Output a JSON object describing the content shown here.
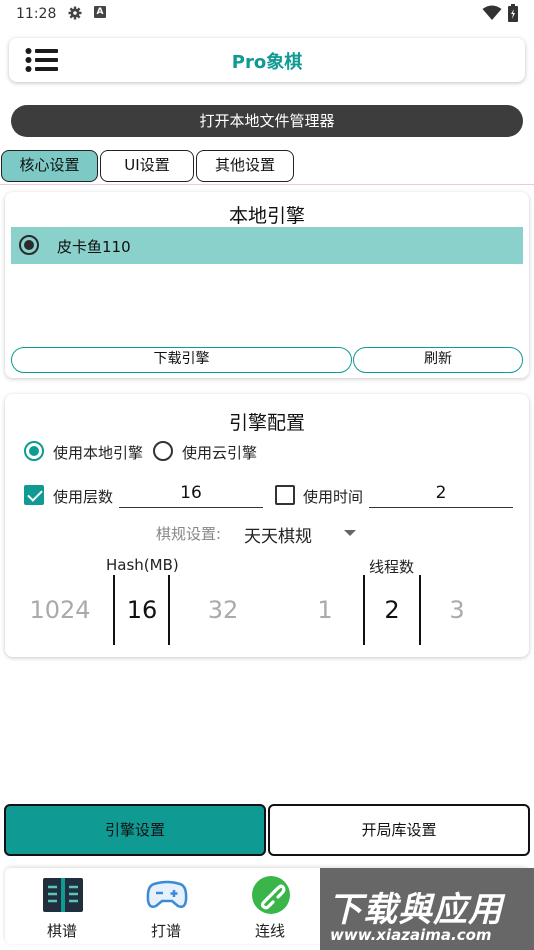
{
  "status_bar": {
    "time": "11:28",
    "notification_letter": "A"
  },
  "app_bar": {
    "title": "Pro象棋"
  },
  "file_manager_button": "打开本地文件管理器",
  "tabs": [
    {
      "label": "核心设置",
      "active": true
    },
    {
      "label": "UI设置",
      "active": false
    },
    {
      "label": "其他设置",
      "active": false
    }
  ],
  "local_engine": {
    "title": "本地引擎",
    "engines": [
      {
        "name": "皮卡鱼110",
        "selected": true
      }
    ],
    "download_label": "下载引擎",
    "refresh_label": "刷新"
  },
  "engine_config": {
    "title": "引擎配置",
    "use_local_label": "使用本地引擎",
    "use_cloud_label": "使用云引擎",
    "local_selected": true,
    "use_depth_label": "使用层数",
    "use_depth_checked": true,
    "depth_value": "16",
    "use_time_label": "使用时间",
    "use_time_checked": false,
    "time_value": "2",
    "rule_label": "棋规设置:",
    "rule_value": "天天棋规",
    "hash_label": "Hash(MB)",
    "hash_options": [
      "1024",
      "16",
      "32"
    ],
    "threads_label": "线程数",
    "threads_options": [
      "1",
      "2",
      "3"
    ]
  },
  "bottom_buttons": {
    "engine_settings": "引擎设置",
    "opening_settings": "开局库设置"
  },
  "nav": [
    {
      "label": "棋谱",
      "icon": "book-icon"
    },
    {
      "label": "打谱",
      "icon": "gamepad-icon"
    },
    {
      "label": "连线",
      "icon": "link-icon"
    }
  ],
  "watermark": {
    "title": "下载與应用",
    "url": "www.xiazaima.com"
  },
  "colors": {
    "accent": "#109a94",
    "accent_light": "#8ad0cb",
    "dark_button": "#3d3d3d"
  }
}
